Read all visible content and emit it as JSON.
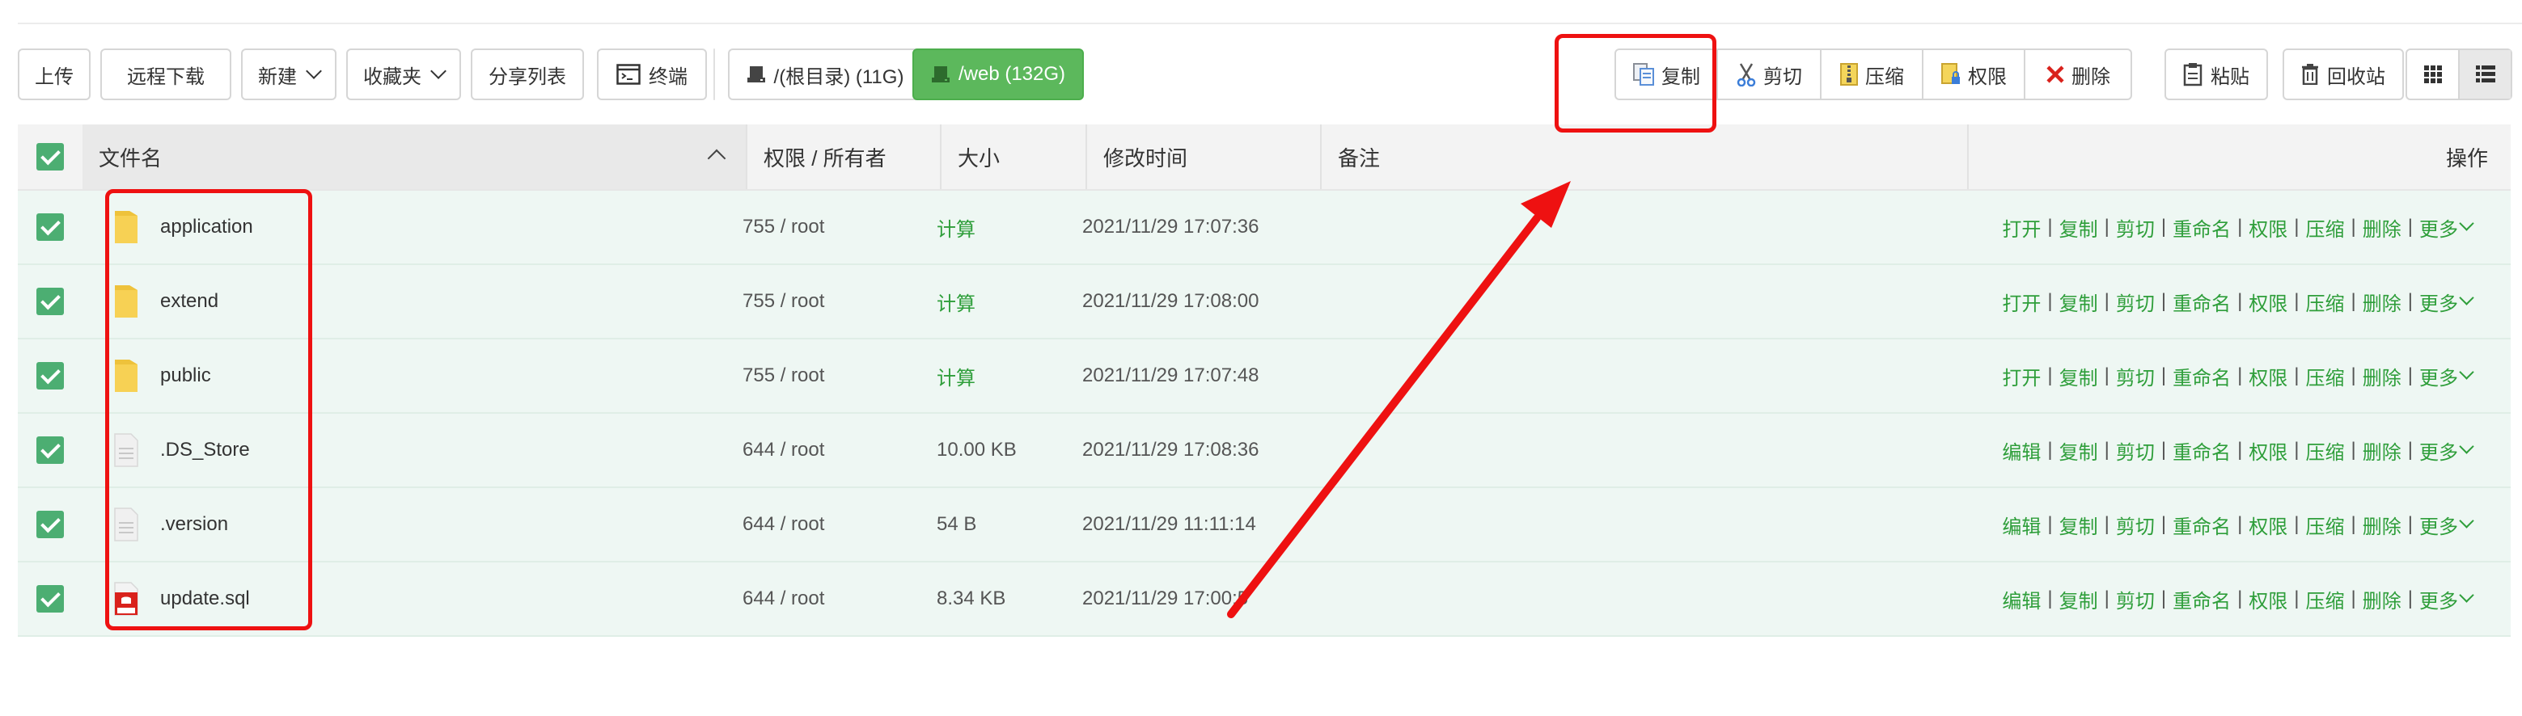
{
  "toolbar": {
    "upload": "上传",
    "remote_download": "远程下载",
    "new": "新建",
    "favorites": "收藏夹",
    "share_list": "分享列表",
    "terminal": "终端",
    "disk_root": "/(根目录) (11G)",
    "disk_web": "/web (132G)",
    "copy": "复制",
    "cut": "剪切",
    "compress": "压缩",
    "permission": "权限",
    "delete": "删除",
    "paste": "粘贴",
    "recycle": "回收站"
  },
  "table": {
    "headers": {
      "filename": "文件名",
      "perm_owner": "权限 / 所有者",
      "size": "大小",
      "mtime": "修改时间",
      "remark": "备注",
      "actions": "操作"
    },
    "rows": [
      {
        "name": "application",
        "perm": "755 / root",
        "size": "计算",
        "mtime": "2021/11/29 17:07:36",
        "type": "folder",
        "first_op": "打开"
      },
      {
        "name": "extend",
        "perm": "755 / root",
        "size": "计算",
        "mtime": "2021/11/29 17:08:00",
        "type": "folder",
        "first_op": "打开"
      },
      {
        "name": "public",
        "perm": "755 / root",
        "size": "计算",
        "mtime": "2021/11/29 17:07:48",
        "type": "folder",
        "first_op": "打开"
      },
      {
        "name": ".DS_Store",
        "perm": "644 / root",
        "size": "10.00 KB",
        "mtime": "2021/11/29 17:08:36",
        "type": "file",
        "first_op": "编辑"
      },
      {
        "name": ".version",
        "perm": "644 / root",
        "size": "54 B",
        "mtime": "2021/11/29 11:11:14",
        "type": "file",
        "first_op": "编辑"
      },
      {
        "name": "update.sql",
        "perm": "644 / root",
        "size": "8.34 KB",
        "mtime": "2021/11/29 17:00:5",
        "type": "sql",
        "first_op": "编辑"
      }
    ],
    "ops": [
      "复制",
      "剪切",
      "重命名",
      "权限",
      "压缩",
      "删除",
      "更多"
    ],
    "ops_separator": "|"
  },
  "colors": {
    "accent_green": "#5cb85c",
    "link_green": "#2e9e3a",
    "row_bg": "#eef7f3",
    "annotation_red": "#ee1111"
  }
}
